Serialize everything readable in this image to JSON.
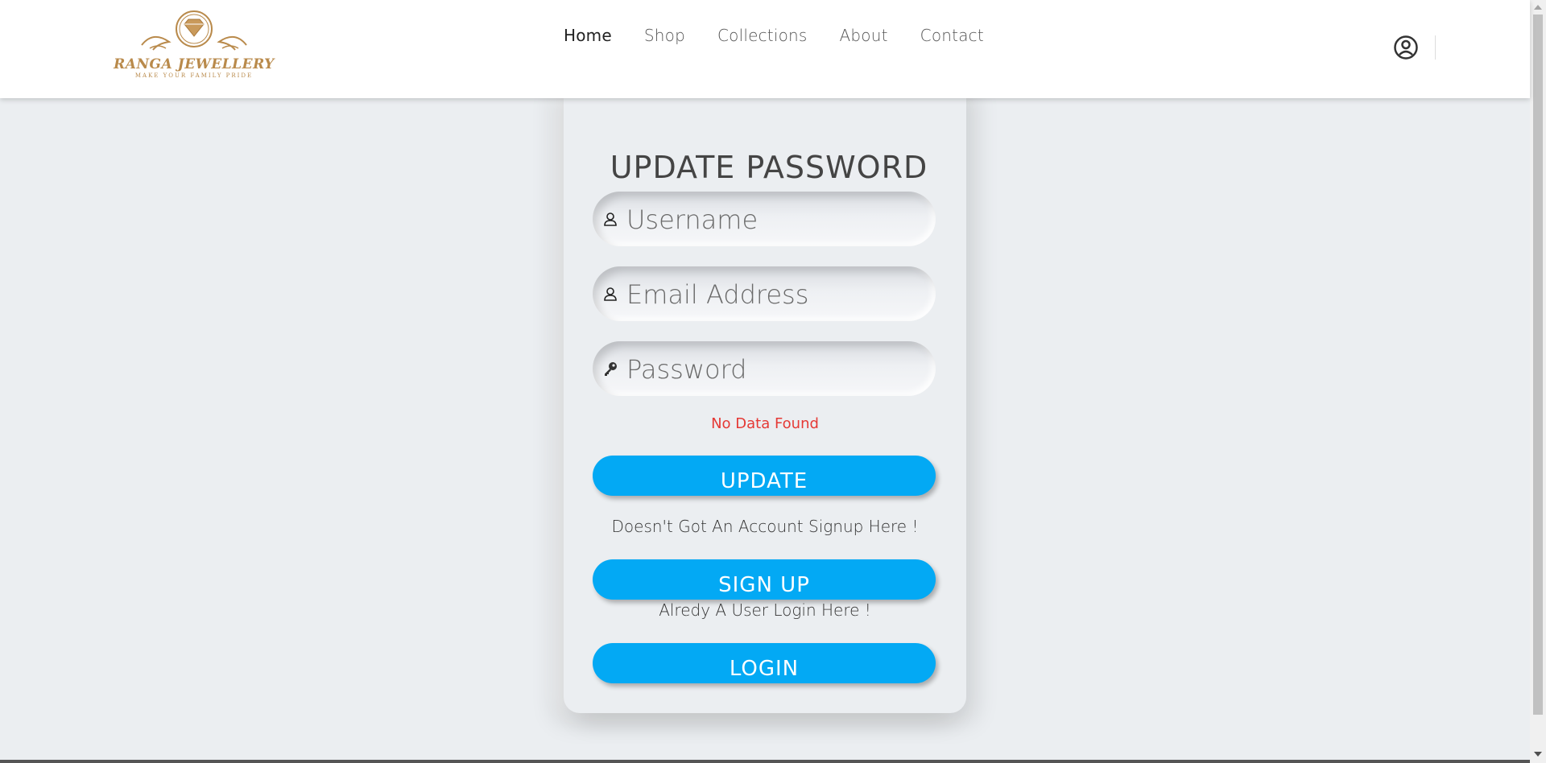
{
  "brand": {
    "name": "RANGA JEWELLERY",
    "tagline": "MAKE YOUR FAMILY PRIDE",
    "color": "#b98a4b"
  },
  "nav": {
    "items": [
      "Home",
      "Shop",
      "Collections",
      "About",
      "Contact"
    ],
    "active": "Home"
  },
  "header": {
    "account_icon": "user-circle-icon"
  },
  "form": {
    "title": "UPDATE PASSWORD",
    "username_placeholder": "Username",
    "email_placeholder": "Email Address",
    "password_placeholder": "Password",
    "error": "No Data Found",
    "update_label": "UPDATE",
    "signup_note": "Doesn't Got An Account Signup Here !",
    "signup_label": "SIGN UP",
    "login_note": "Alredy A User Login Here !",
    "login_label": "LOGIN",
    "button_color": "#03a9f4",
    "error_color": "#e53935"
  }
}
